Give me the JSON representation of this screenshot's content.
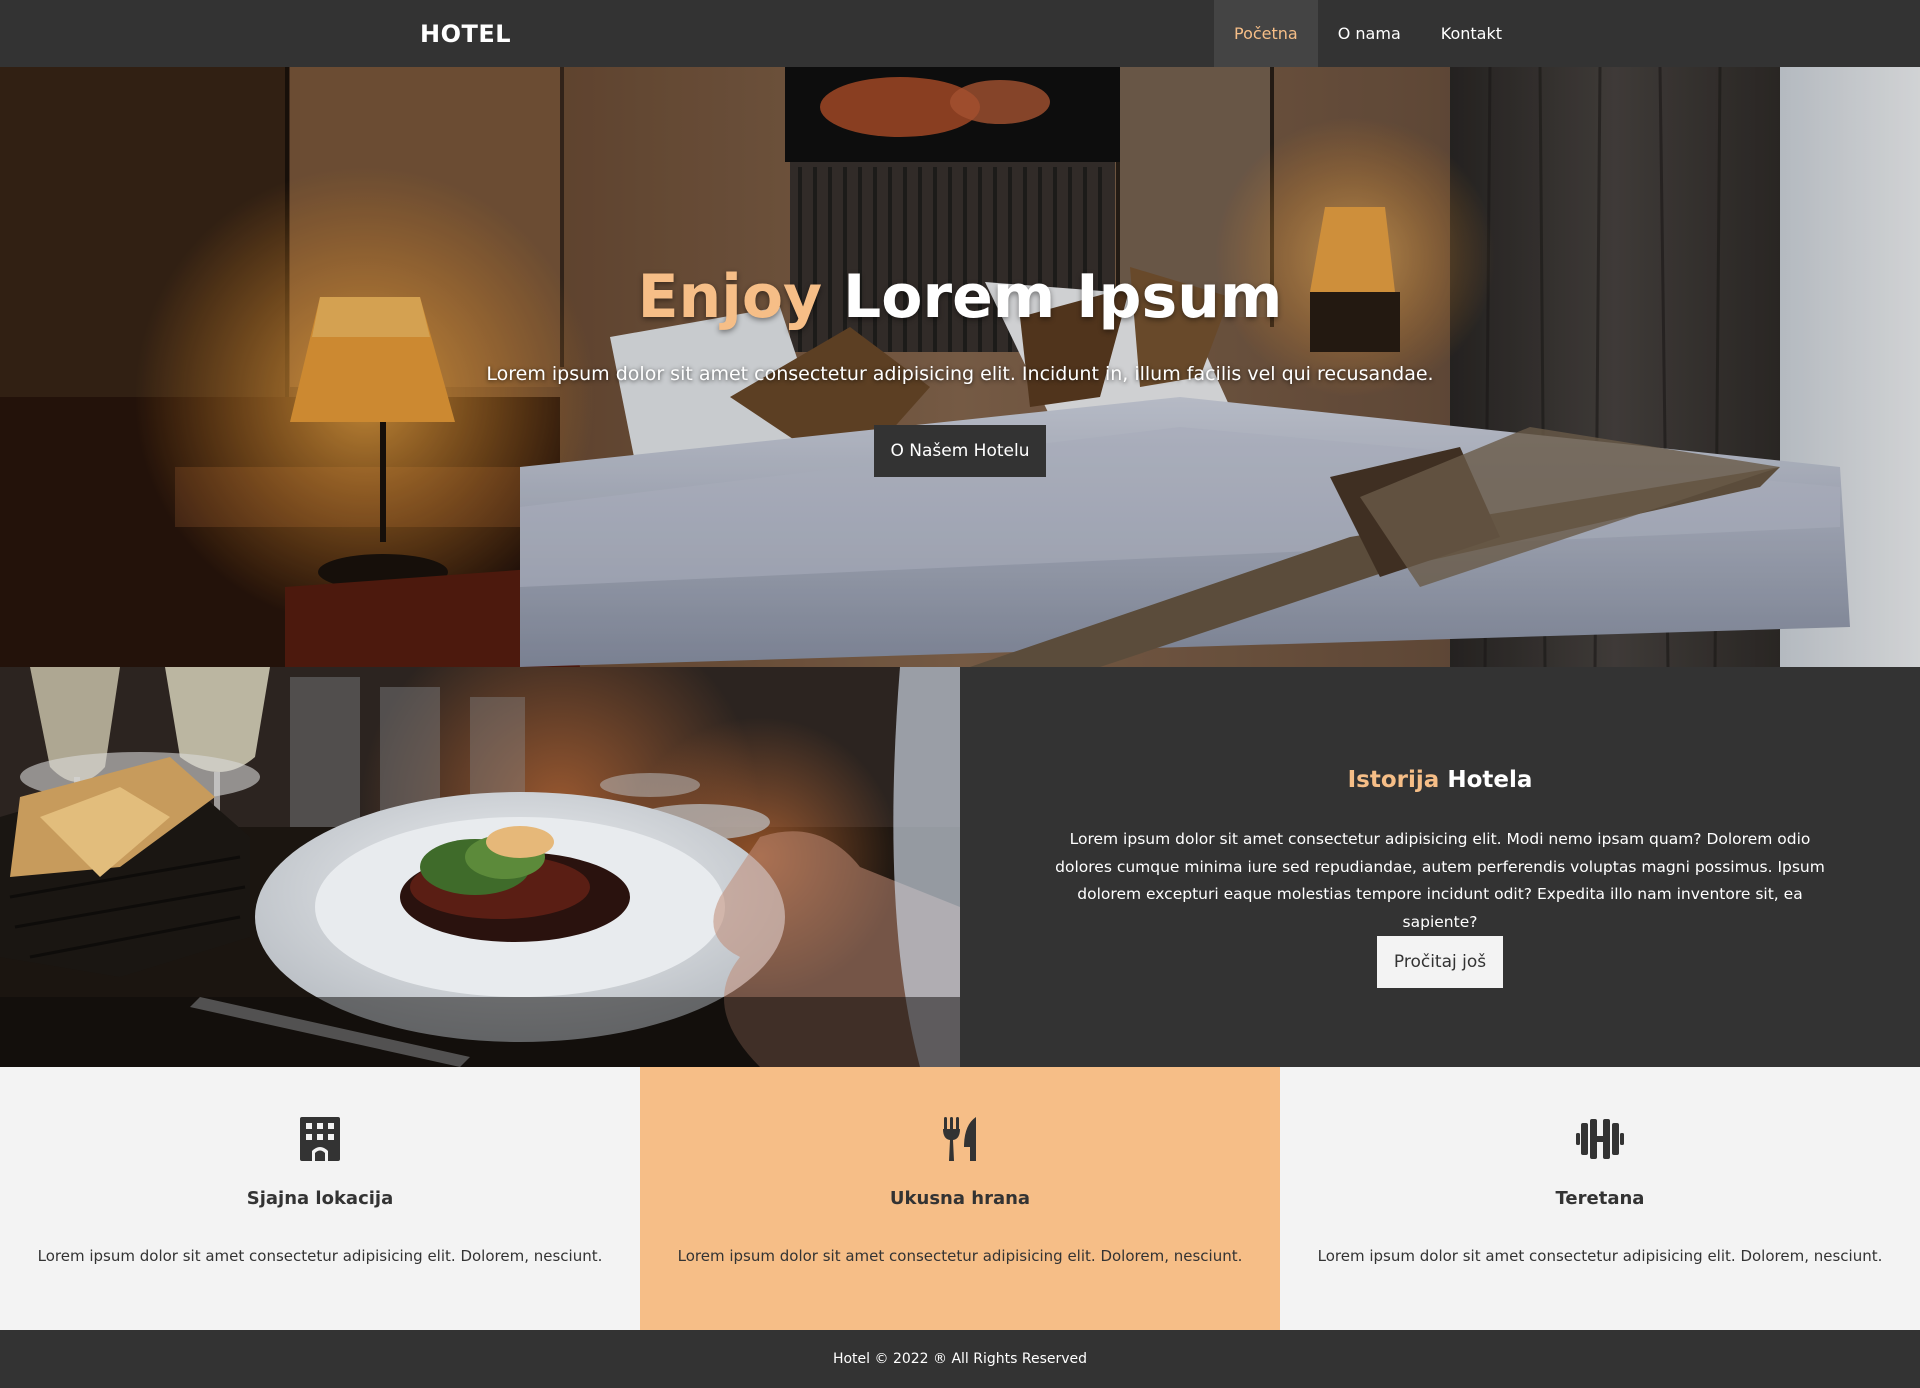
{
  "navbar": {
    "brand": "HOTEL",
    "items": [
      {
        "label": "Početna",
        "active": true
      },
      {
        "label": "O nama",
        "active": false
      },
      {
        "label": "Kontakt",
        "active": false
      }
    ]
  },
  "hero": {
    "title_accent": "Enjoy",
    "title_rest": " Lorem Ipsum",
    "subtitle": "Lorem ipsum dolor sit amet consectetur adipisicing elit. Incidunt in, illum facilis vel qui recusandae.",
    "button_label": "O Našem Hotelu",
    "image": "hotel-bedroom-photo"
  },
  "about": {
    "image": "restaurant-dining-photo",
    "title_accent": "Istorija",
    "title_rest": " Hotela",
    "paragraph": "Lorem ipsum dolor sit amet consectetur adipisicing elit. Modi nemo ipsam quam? Dolorem odio dolores cumque minima iure sed repudiandae, autem perferendis voluptas magni possimus. Ipsum dolorem excepturi eaque molestias tempore incidunt odit? Expedita illo nam inventore sit, ea sapiente?",
    "button_label": "Pročitaj još"
  },
  "features": [
    {
      "icon": "building-icon",
      "title": "Sjajna lokacija",
      "text": "Lorem ipsum dolor sit amet consectetur adipisicing elit. Dolorem, nesciunt."
    },
    {
      "icon": "utensils-icon",
      "title": "Ukusna hrana",
      "text": "Lorem ipsum dolor sit amet consectetur adipisicing elit. Dolorem, nesciunt."
    },
    {
      "icon": "dumbbell-icon",
      "title": "Teretana",
      "text": "Lorem ipsum dolor sit amet consectetur adipisicing elit. Dolorem, nesciunt."
    }
  ],
  "footer": {
    "text": "Hotel © 2022 ® All Rights Reserved"
  },
  "colors": {
    "accent": "#f6be87",
    "dark": "#333333",
    "light": "#f3f3f3"
  }
}
